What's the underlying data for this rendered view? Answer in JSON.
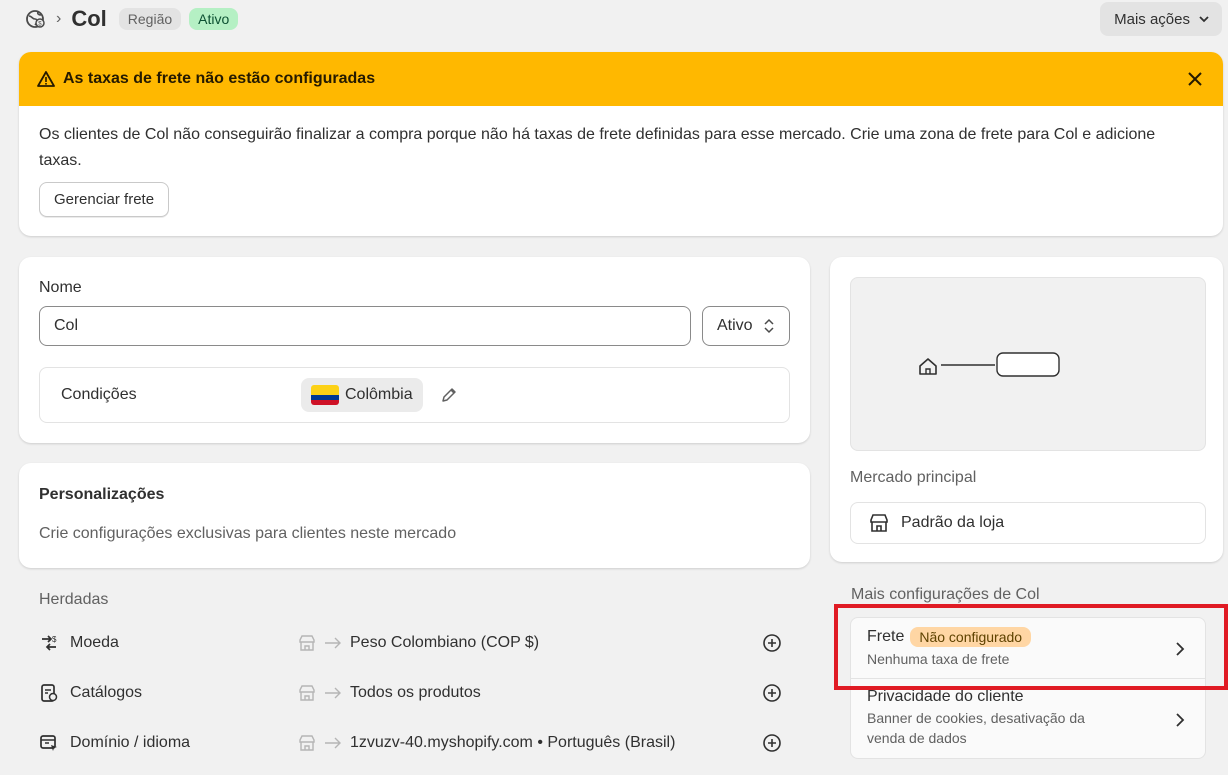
{
  "header": {
    "title": "Col",
    "badge_type": "Região",
    "badge_status": "Ativo",
    "more_actions": "Mais ações"
  },
  "banner": {
    "title": "As taxas de frete não estão configuradas",
    "text": "Os clientes de Col não conseguirão finalizar a compra porque não há taxas de frete definidas para esse mercado. Crie uma zona de frete para Col e adicione taxas.",
    "button": "Gerenciar frete"
  },
  "name_card": {
    "label": "Nome",
    "value": "Col",
    "status": "Ativo",
    "conditions_label": "Condições",
    "country": "Colômbia"
  },
  "personalizations": {
    "title": "Personalizações",
    "description": "Crie configurações exclusivas para clientes neste mercado"
  },
  "inherited": {
    "heading": "Herdadas",
    "rows": [
      {
        "name": "Moeda",
        "value": "Peso Colombiano (COP $)",
        "icon": "currency-exchange-icon"
      },
      {
        "name": "Catálogos",
        "value": "Todos os produtos",
        "icon": "catalog-icon"
      },
      {
        "name": "Domínio / idioma",
        "value": "1zvuzv-40.myshopify.com • Português (Brasil)",
        "icon": "domain-language-icon"
      }
    ]
  },
  "market": {
    "primary_label": "Mercado principal",
    "store_default": "Padrão da loja",
    "more_settings": "Mais configurações de Col",
    "settings": [
      {
        "title": "Frete",
        "badge": "Não configurado",
        "subtitle": "Nenhuma taxa de frete"
      },
      {
        "title": "Privacidade do cliente",
        "subtitle_line1": "Banner de cookies, desativação da",
        "subtitle_line2": "venda de dados"
      }
    ]
  },
  "colors": {
    "warning": "#ffb800",
    "active_badge": "#b5f0c4",
    "highlight": "#e01b24",
    "orange_badge": "#ffd6a4"
  }
}
